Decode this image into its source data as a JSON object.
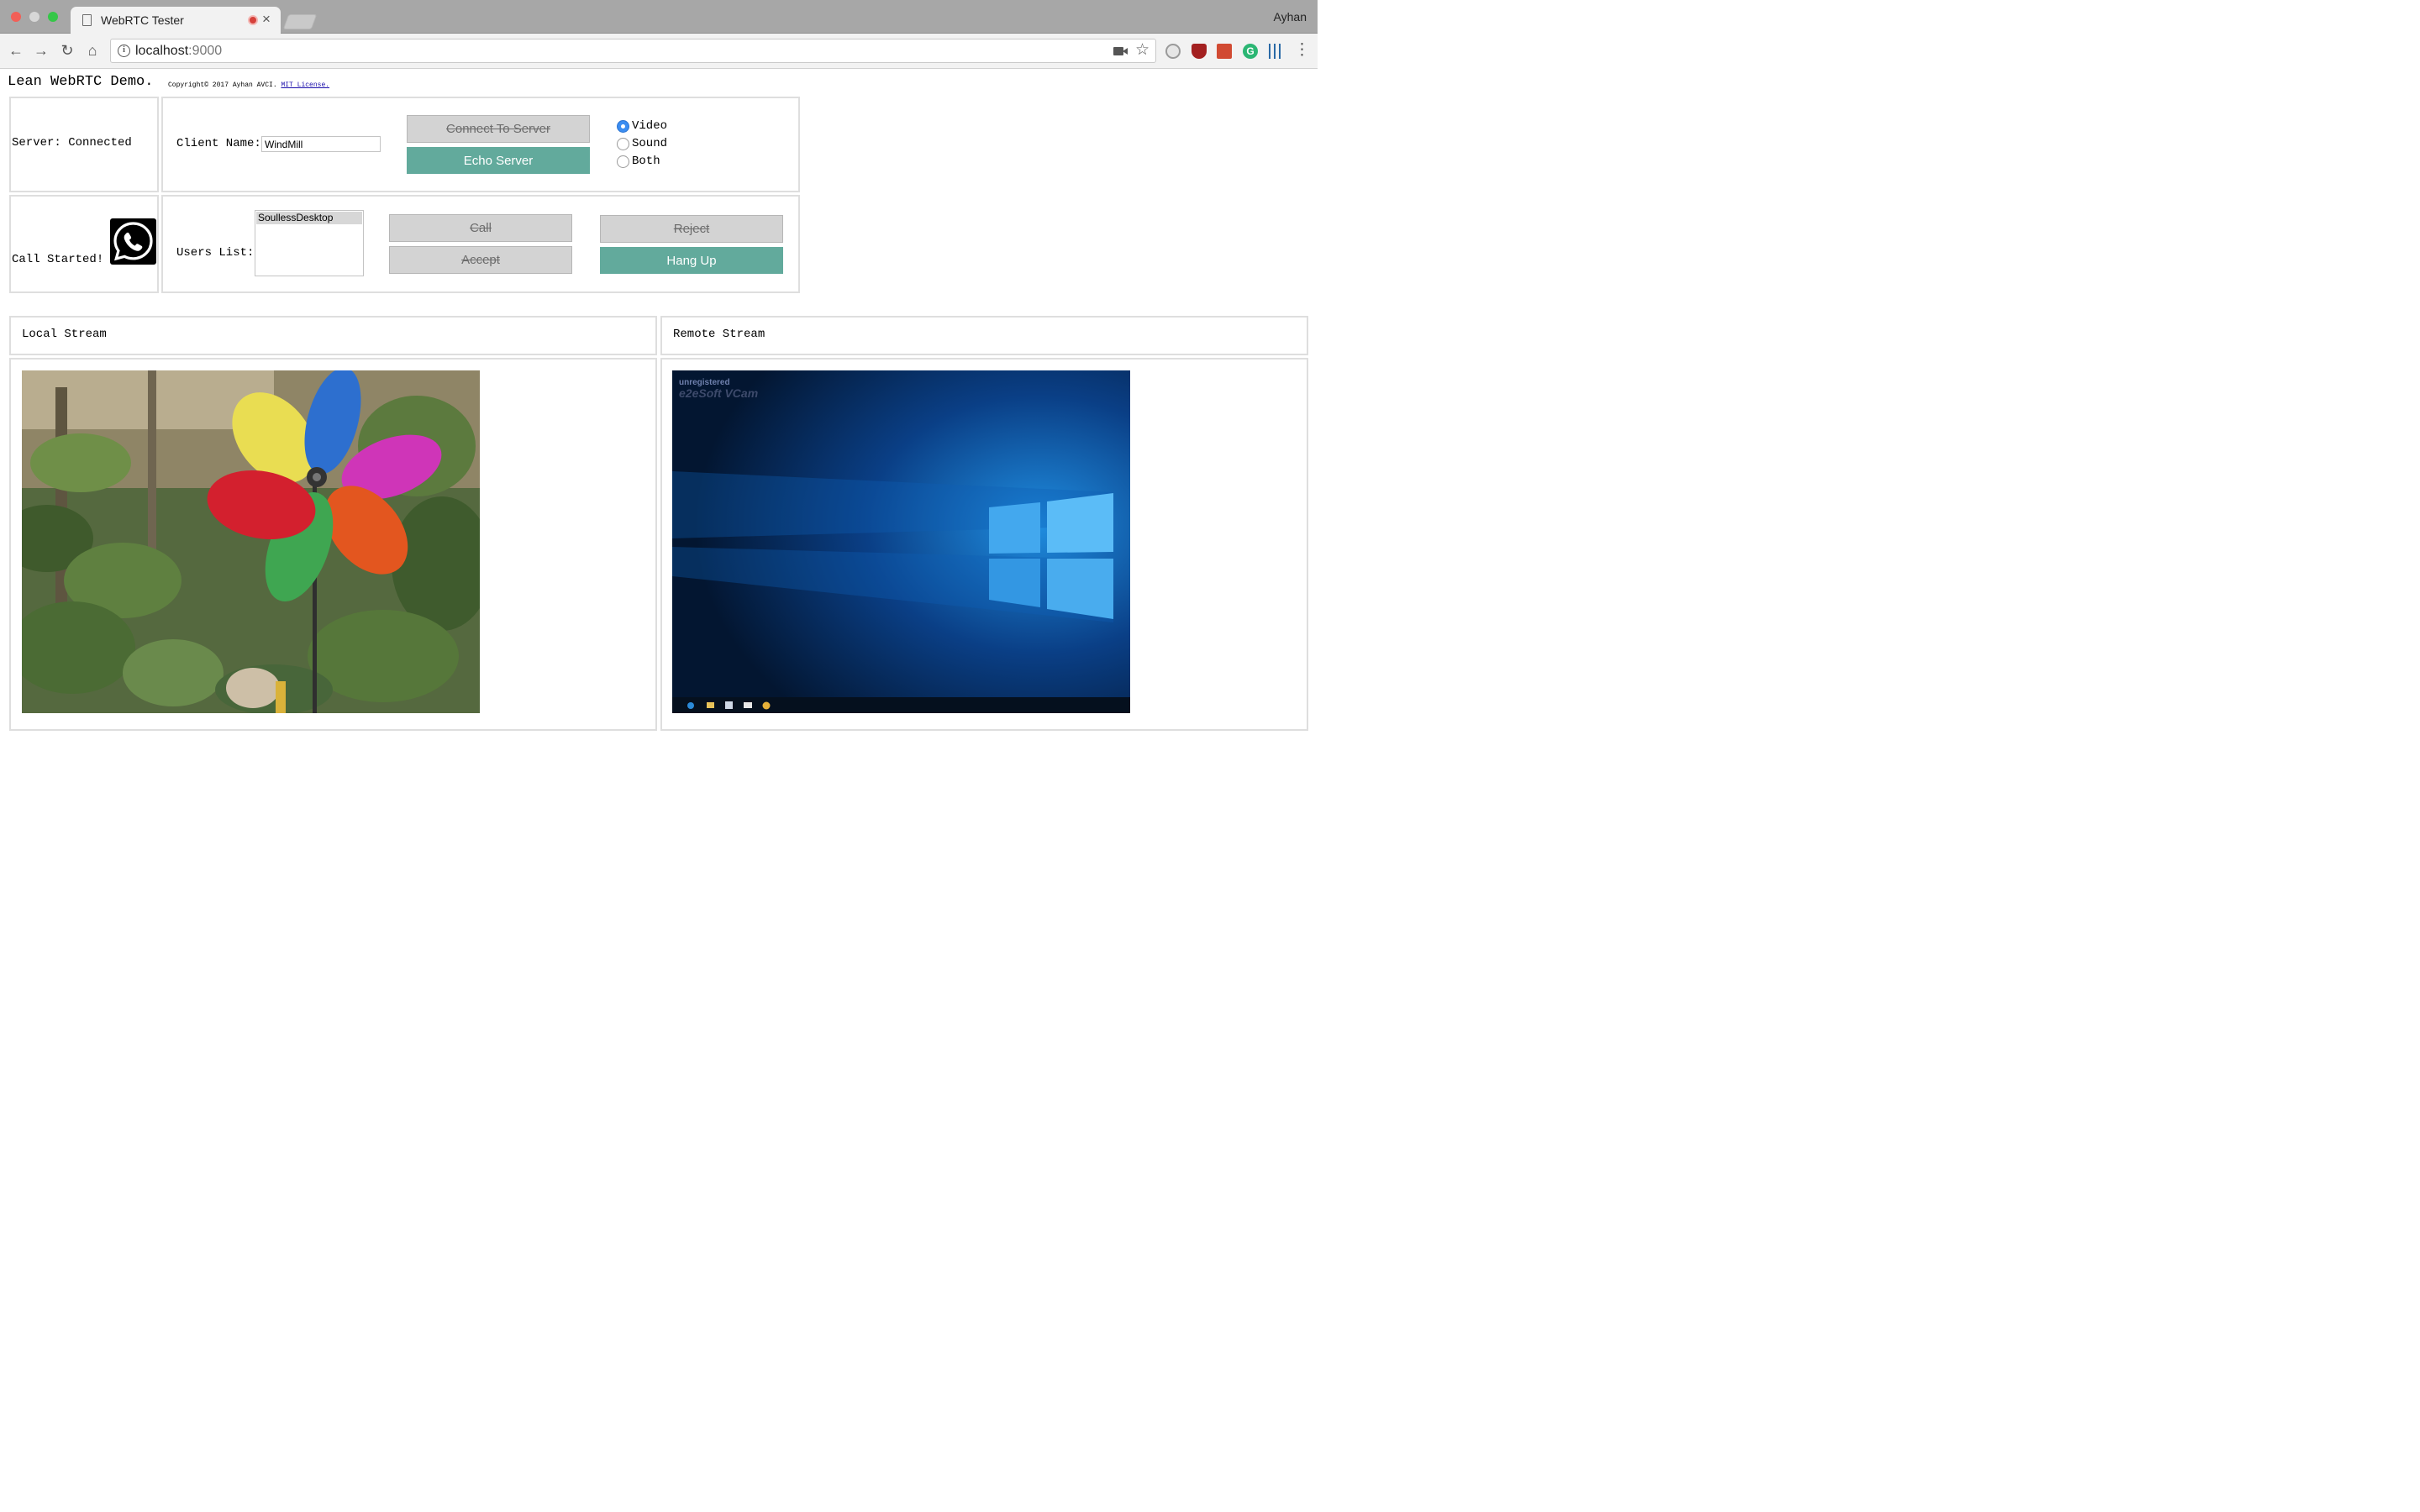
{
  "browser": {
    "tab_title": "WebRTC Tester",
    "profile_name": "Ayhan",
    "url_host": "localhost",
    "url_port": ":9000"
  },
  "page": {
    "title": "Lean WebRTC Demo.",
    "copyright": "Copyright© 2017 Ayhan AVCI.",
    "license_link": "MIT License."
  },
  "server": {
    "status_label": "Server: Connected"
  },
  "client": {
    "name_label": "Client Name:",
    "name_value": "WindMill"
  },
  "buttons": {
    "connect": "Connect To Server",
    "echo": "Echo Server",
    "call": "Call",
    "accept": "Accept",
    "reject": "Reject",
    "hang_up": "Hang Up"
  },
  "media_options": [
    {
      "label": "Video",
      "checked": true
    },
    {
      "label": "Sound",
      "checked": false
    },
    {
      "label": "Both",
      "checked": false
    }
  ],
  "call": {
    "status_label": "Call Started!"
  },
  "users": {
    "label": "Users List:",
    "items": [
      "SoullessDesktop"
    ]
  },
  "streams": {
    "local_label": "Local Stream",
    "remote_label": "Remote Stream",
    "remote_watermark_1": "unregistered",
    "remote_watermark_2": "e2eSoft VCam"
  },
  "colors": {
    "active_button": "#62aa9c",
    "disabled_button": "#d3d3d3",
    "radio_checked": "#3b8df1"
  }
}
